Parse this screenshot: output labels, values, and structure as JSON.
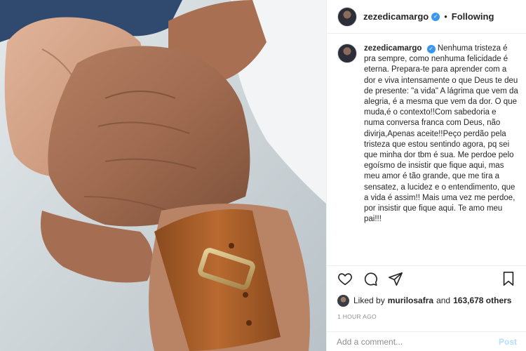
{
  "post": {
    "author": "zezedicamargo",
    "follow_status": "Following",
    "separator": "•",
    "photo_alt": "Two hands clasped, one wearing a brown leather watch"
  },
  "caption": {
    "username": "zezedicamargo",
    "text": "Nenhuma tristeza é pra sempre, como nenhuma felicidade é eterna. Prepara-te para aprender com a dor e viva intensamente o que Deus te deu de presente: \"a vida\" A lágrima que vem da alegria, é a mesma que vem da dor. O que muda,é o contexto!!Com sabedoria e numa conversa franca com Deus, não divirja,Apenas aceite!!Peço perdão pela tristeza que estou sentindo agora, pq sei que minha dor tbm é sua. Me perdoe pelo egoísmo de insistir que fique aqui, mas meu amor é tão grande, que me tira a sensatez, a lucidez e o entendimento, que a vida é assim!! Mais uma vez me perdoe, por insistir que fique aqui. Te amo meu pai!!!"
  },
  "actions": {
    "like": "heart-icon",
    "comment": "comment-icon",
    "share": "share-icon",
    "save": "bookmark-icon"
  },
  "likes": {
    "prefix": "Liked by",
    "user": "murilosafra",
    "conjunction": "and",
    "count": "163,678 others"
  },
  "timestamp": "1 HOUR AGO",
  "comment": {
    "placeholder": "Add a comment...",
    "post_label": "Post"
  },
  "colors": {
    "verified": "#3897f0",
    "post_disabled": "#b2dffc",
    "muted": "#8e8e8e"
  }
}
